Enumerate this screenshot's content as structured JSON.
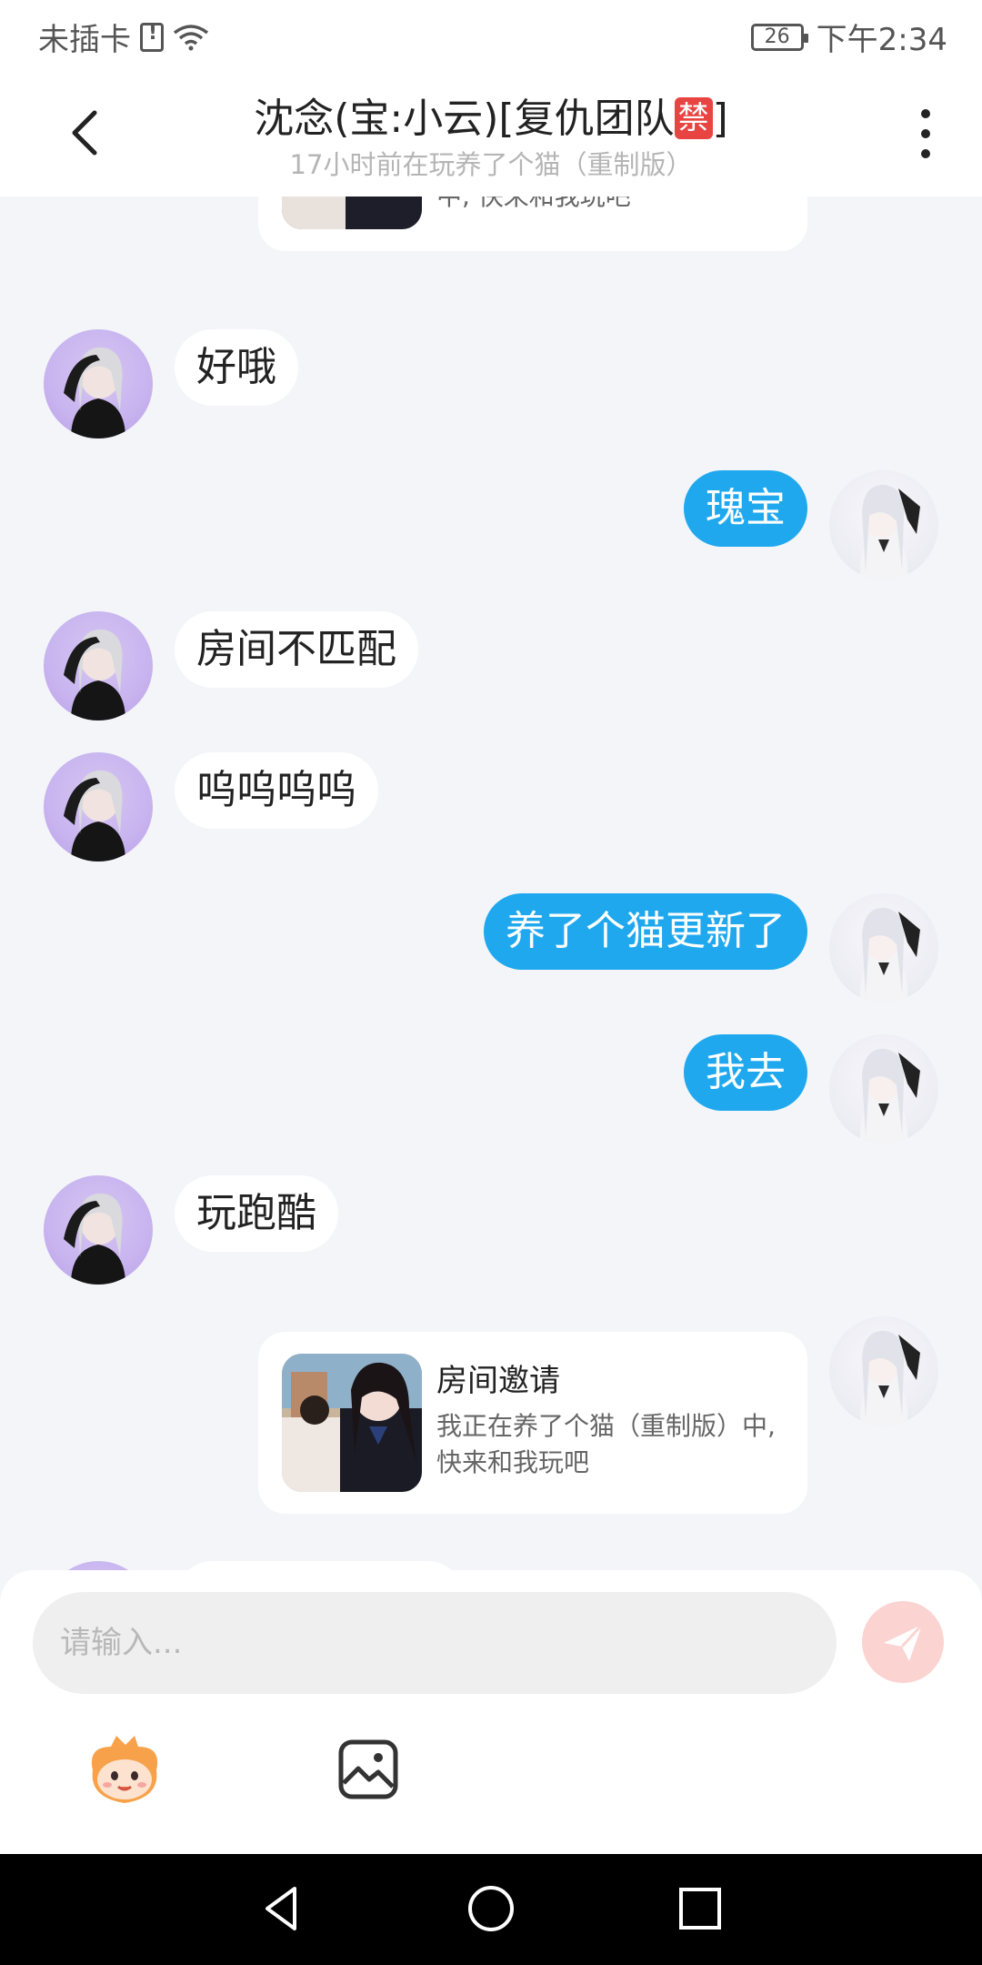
{
  "status_bar": {
    "carrier": "未插卡",
    "battery": "26",
    "time": "下午2:34"
  },
  "header": {
    "title": "沈念(宝:小云)[复仇团队",
    "title_badge": "禁",
    "title_end": "]",
    "subtitle": "17小时前在玩养了个猫（重制版）"
  },
  "messages": [
    {
      "side": "other",
      "text": "好哦"
    },
    {
      "side": "me",
      "text": "瑰宝"
    },
    {
      "side": "other",
      "text": "房间不匹配"
    },
    {
      "side": "other",
      "text": "呜呜呜呜"
    },
    {
      "side": "me",
      "text": "养了个猫更新了"
    },
    {
      "side": "me",
      "text": "我去"
    },
    {
      "side": "other",
      "text": "玩跑酷"
    }
  ],
  "invite_top": {
    "desc_partial": "中, 快来和我玩吧"
  },
  "invite": {
    "title": "房间邀请",
    "desc": "我正在养了个猫（重制版）中, 快来和我玩吧"
  },
  "input": {
    "placeholder": "请输入..."
  },
  "colors": {
    "accent_blue": "#1fa8ee",
    "send_button": "#fbd3d1",
    "ban_badge": "#e84542"
  },
  "icons": {
    "back": "chevron-left-icon",
    "more": "more-vertical-icon",
    "send": "paper-plane-icon",
    "emoji": "emoji-mascot-icon",
    "image": "image-icon",
    "nav_back": "triangle-back-icon",
    "nav_home": "circle-home-icon",
    "nav_recent": "square-recent-icon"
  }
}
